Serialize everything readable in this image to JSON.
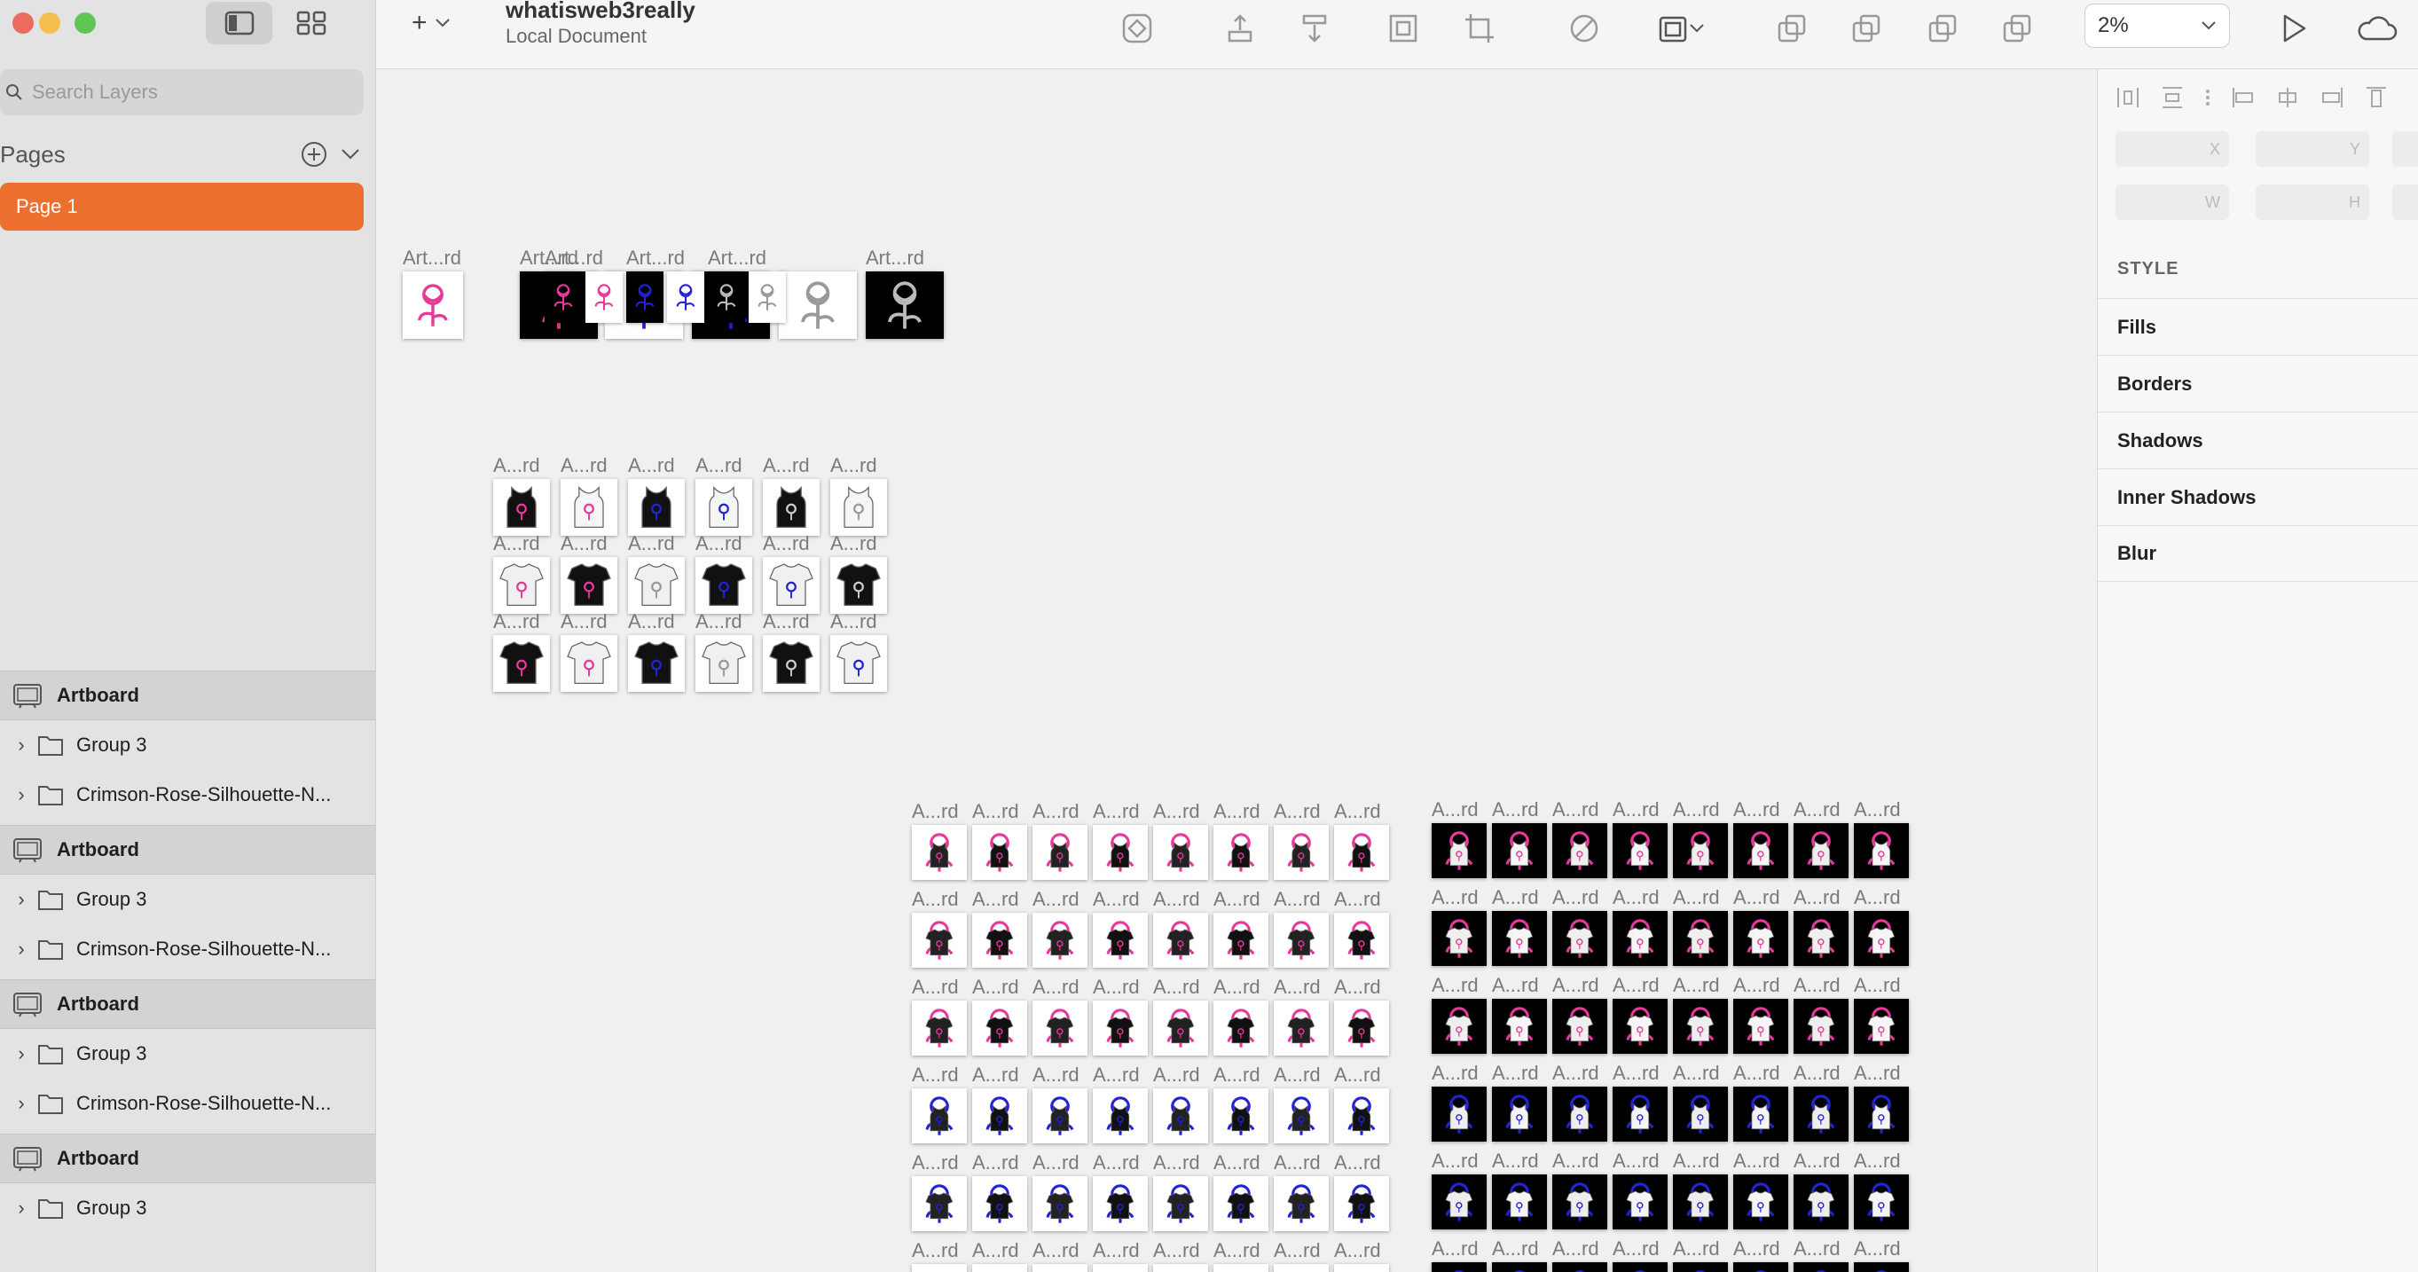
{
  "document": {
    "title": "whatisweb3really",
    "subtitle": "Local Document"
  },
  "sidebar": {
    "search_placeholder": "Search Layers",
    "pages_label": "Pages",
    "pages": [
      {
        "label": "Page 1",
        "selected": true
      }
    ],
    "layers": [
      {
        "label": "Artboard",
        "children": [
          "Group 3",
          "Crimson-Rose-Silhouette-N..."
        ]
      },
      {
        "label": "Artboard",
        "children": [
          "Group 3",
          "Crimson-Rose-Silhouette-N..."
        ]
      },
      {
        "label": "Artboard",
        "children": [
          "Group 3",
          "Crimson-Rose-Silhouette-N..."
        ]
      },
      {
        "label": "Artboard",
        "children": [
          "Group 3"
        ]
      }
    ]
  },
  "toolbar": {
    "zoom": "2%",
    "icons": [
      "insert-icon",
      "create-symbol-icon",
      "forward-icon",
      "backward-icon",
      "group-icon",
      "ungroup-icon",
      "edit-path-icon",
      "mask-icon",
      "union-icon",
      "subtract-icon",
      "intersect-icon",
      "difference-icon",
      "preview-play-icon",
      "cloud-icon"
    ]
  },
  "canvas": {
    "art_label": "Art...rd",
    "a_label": "A...rd",
    "artboards_top": [
      "Art...rd",
      "Art...rd",
      "Art...rd"
    ]
  },
  "inspector": {
    "x_label": "X",
    "y_label": "Y",
    "w_label": "W",
    "h_label": "H",
    "style_label": "STYLE",
    "sections": [
      "Fills",
      "Borders",
      "Shadows",
      "Inner Shadows",
      "Blur"
    ]
  },
  "colors": {
    "accent": "#ec6f30",
    "pink": "#e8389a",
    "blue": "#2323d6"
  }
}
